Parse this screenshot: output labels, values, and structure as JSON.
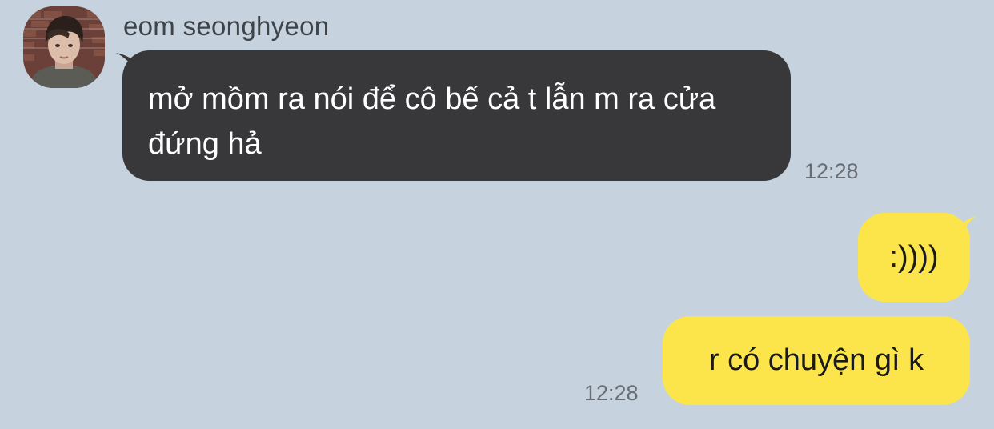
{
  "conversation": {
    "incoming": {
      "sender_name": "eom seonghyeon",
      "avatar_icon": "profile-photo",
      "message_text": "mở mồm ra nói để cô bế cả t lẫn m ra cửa đứng hả",
      "timestamp": "12:28"
    },
    "outgoing": [
      {
        "message_text": ":))))"
      },
      {
        "message_text": "r có chuyện gì k",
        "timestamp": "12:28"
      }
    ]
  },
  "colors": {
    "background": "#c6d3df",
    "incoming_bubble": "#38383a",
    "outgoing_bubble": "#fbe54a",
    "timestamp_text": "#676d73"
  }
}
